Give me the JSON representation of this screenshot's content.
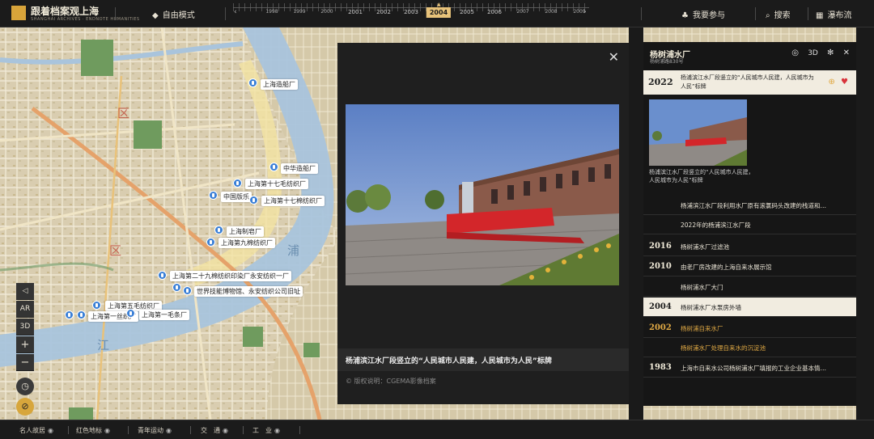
{
  "app": {
    "title": "跟着档案观上海",
    "subtitle": "SHANGHAI ARCHIVES  ·  ENDNOTE HUMANITIES"
  },
  "topbar": {
    "mode_label": "自由模式",
    "participate_label": "我要参与",
    "search_label": "搜索",
    "waterfall_label": "瀑布流"
  },
  "timeline": {
    "years": [
      "1998",
      "1999",
      "2000",
      "2001",
      "2002",
      "2003",
      "2004",
      "2005",
      "2006",
      "2007",
      "2008",
      "2009",
      "2010"
    ],
    "active_year": "2004"
  },
  "map_controls": {
    "ar_label": "AR",
    "view3d_label": "3D",
    "zoom_in": "+",
    "zoom_out": "−"
  },
  "map": {
    "pins": [
      "上海造船厂",
      "中华造船厂",
      "上海第十七毛纺织厂",
      "中国版乐",
      "上海第十七棉纺织厂",
      "上海制皂厂",
      "上海第九棉纺织厂",
      "上海第二十九棉纺织印染厂永安纺织一厂",
      "世界技能博物馆、永安纺织公司旧址",
      "上海第五毛纺织厂",
      "上海第一丝织厂",
      "上海第一毛条厂"
    ],
    "river_labels": [
      "浦",
      "江"
    ],
    "district_labels": [
      "区",
      "浦"
    ]
  },
  "photo_panel": {
    "caption": "杨浦滨江水厂段竖立的“人民城市人民建，人民城市为人民”标牌",
    "copyright": "© 版权说明：CGEMA影像档案"
  },
  "sidebar": {
    "title": "杨树浦水厂",
    "subtitle": "杨树浦路830号",
    "view3d": "3D",
    "active_item": {
      "year": "2022",
      "text": "杨浦滨江水厂段竖立的“人民城市人民建，人民城市为人民”标牌"
    },
    "thumb_caption": "杨浦滨江水厂段竖立的“人民城市人民建，人民城市为人民”标牌",
    "items": [
      {
        "year": "",
        "text": "杨浦滨江水厂段利用水厂原有滚氯码头改建的栈道和…",
        "style": ""
      },
      {
        "year": "",
        "text": "2022年的杨浦滨江水厂段",
        "style": ""
      },
      {
        "year": "2016",
        "text": "杨树浦水厂过滤池",
        "style": ""
      },
      {
        "year": "2010",
        "text": "由老厂房改建的上海自来水展示馆",
        "style": ""
      },
      {
        "year": "",
        "text": "杨树浦水厂大门",
        "style": ""
      },
      {
        "year": "2004",
        "text": "杨树浦水厂水泵房外墙",
        "style": "hl"
      },
      {
        "year": "2002",
        "text": "杨树浦自来水厂",
        "style": "gold"
      },
      {
        "year": "",
        "text": "杨树浦水厂处理自来水的沉淀池",
        "style": "gold"
      },
      {
        "year": "1983",
        "text": "上海市自来水公司杨树浦水厂填报的工业企业基本情…",
        "style": ""
      }
    ]
  },
  "bottombar": {
    "layers": [
      "名人故居",
      "红色地标",
      "青年运动",
      "交　通",
      "工　业"
    ]
  },
  "colors": {
    "accent_gold": "#e7c27a",
    "pin_blue": "#3a7fd6",
    "river": "#a9c4dc",
    "map_bg": "#d7ccae"
  }
}
